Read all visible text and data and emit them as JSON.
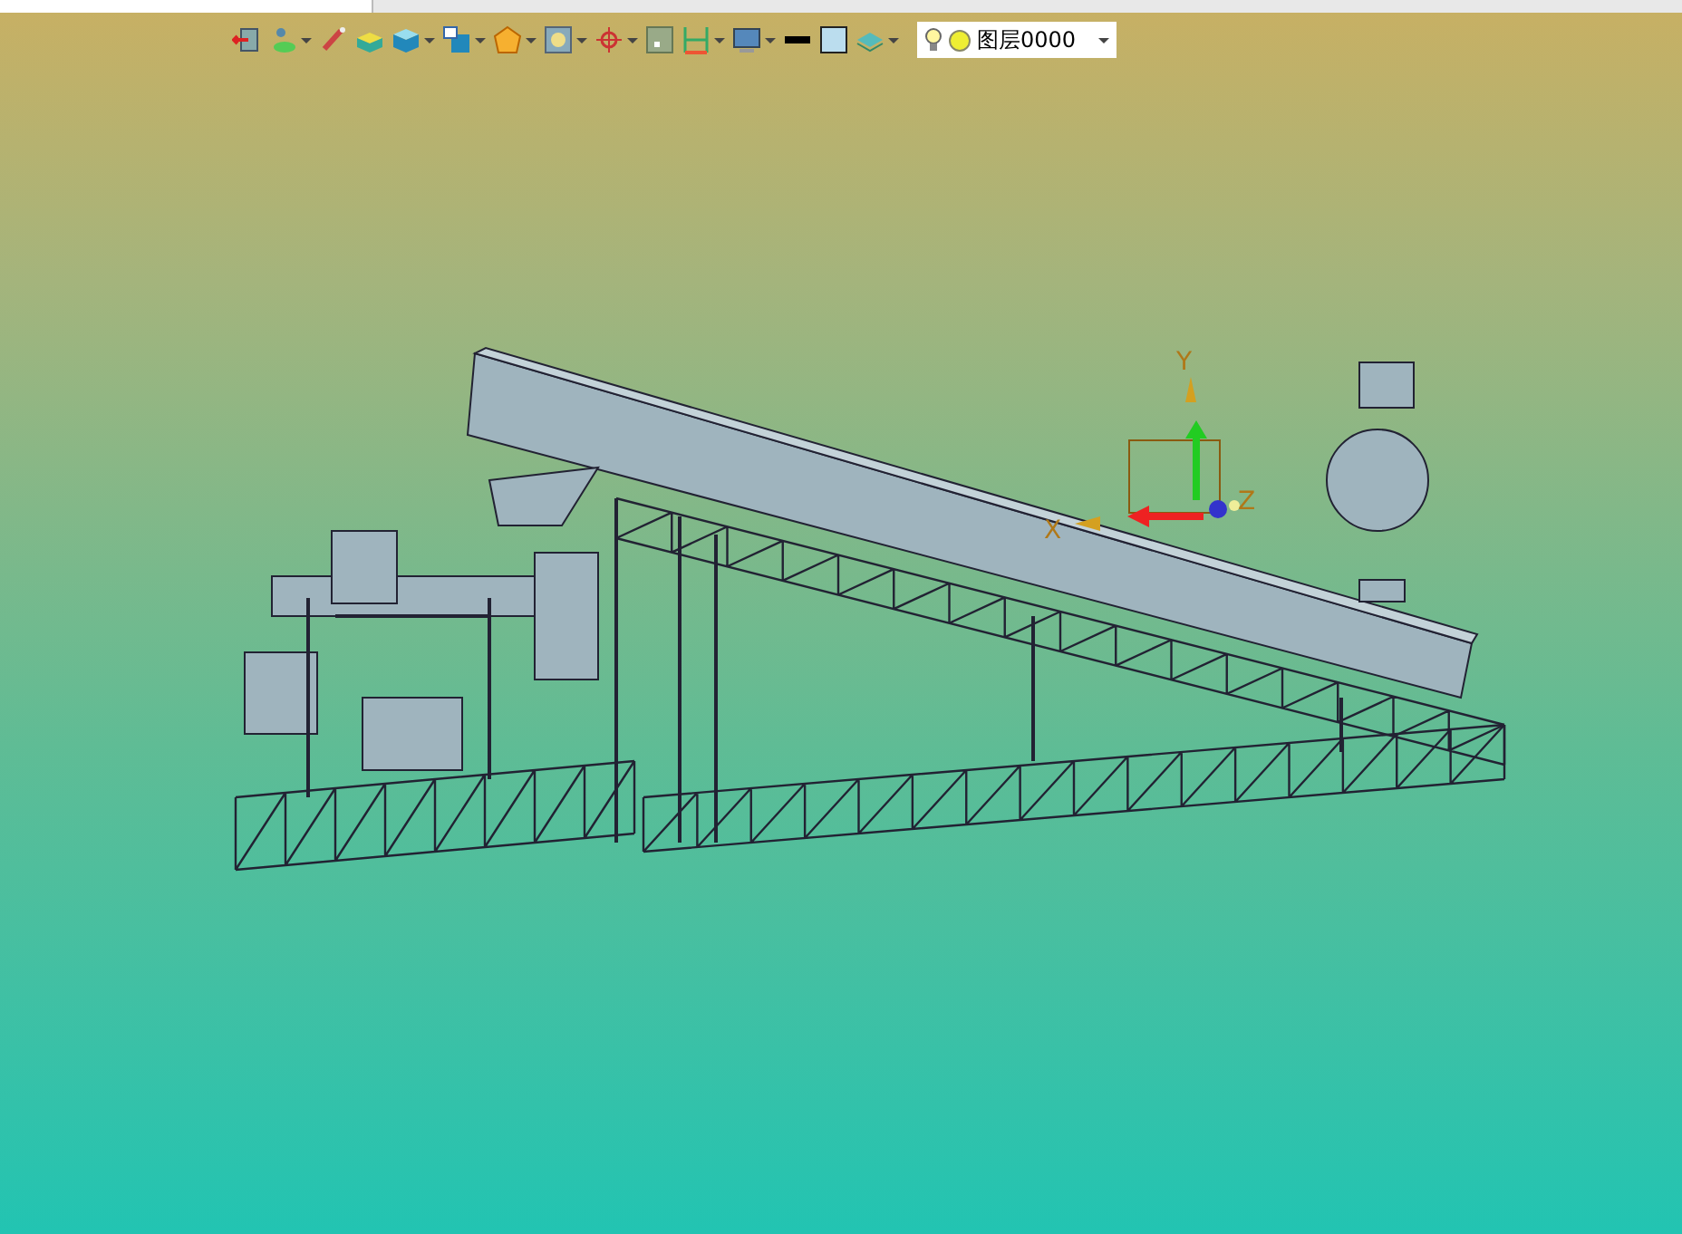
{
  "toolbar": {
    "items": [
      {
        "kind": "exit",
        "has_menu": false
      },
      {
        "kind": "layers",
        "has_menu": true
      },
      {
        "kind": "brush",
        "has_menu": false
      },
      {
        "kind": "box",
        "has_menu": false
      },
      {
        "kind": "cube",
        "has_menu": true
      },
      {
        "kind": "view",
        "has_menu": true
      },
      {
        "kind": "polygon",
        "has_menu": true
      },
      {
        "kind": "frame",
        "has_menu": true
      },
      {
        "kind": "target",
        "has_menu": true
      },
      {
        "kind": "square",
        "has_menu": false
      },
      {
        "kind": "dimension",
        "has_menu": true
      },
      {
        "kind": "monitor",
        "has_menu": true
      },
      {
        "kind": "line",
        "has_menu": false
      },
      {
        "kind": "fill",
        "has_menu": false
      },
      {
        "kind": "stack",
        "has_menu": true
      }
    ],
    "layer": {
      "name": "图层0000",
      "visible": true
    }
  },
  "viewport": {
    "axes": {
      "x": "X",
      "y": "Y",
      "z": "Z"
    }
  }
}
